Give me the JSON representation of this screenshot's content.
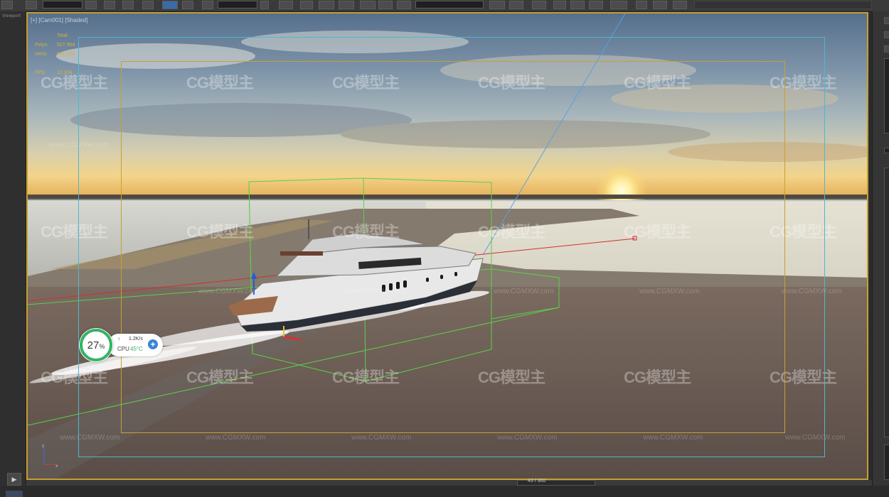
{
  "viewport": {
    "label": "[+] [Cam001] [Shaded]",
    "stats": {
      "total_label": "Total",
      "polys_label": "Polys:",
      "polys_value": "527,964",
      "verts_label": "Verts:",
      "verts_value": "946,830",
      "fps_label": "FPS:",
      "fps_value": "12.334"
    },
    "watermark_text": "CG模型主",
    "watermark_small": "www.CGMXW.com"
  },
  "cpu_widget": {
    "percent": "27",
    "percent_unit": "%",
    "net_arrow": "↑",
    "net_speed": "1.2K/s",
    "cpu_label": "CPU",
    "cpu_temp": "45°C",
    "plus": "+"
  },
  "left_panel": {
    "side_label": "Viewport",
    "play": "▶"
  },
  "status": {
    "frame_counter": "43 / 300"
  },
  "colors": {
    "safe_frame_outer": "#4fb8d0",
    "safe_frame_inner": "#c8a030",
    "selection_box": "#5cd04a",
    "target_line": "#d03030",
    "viewport_border": "#c4a032"
  }
}
